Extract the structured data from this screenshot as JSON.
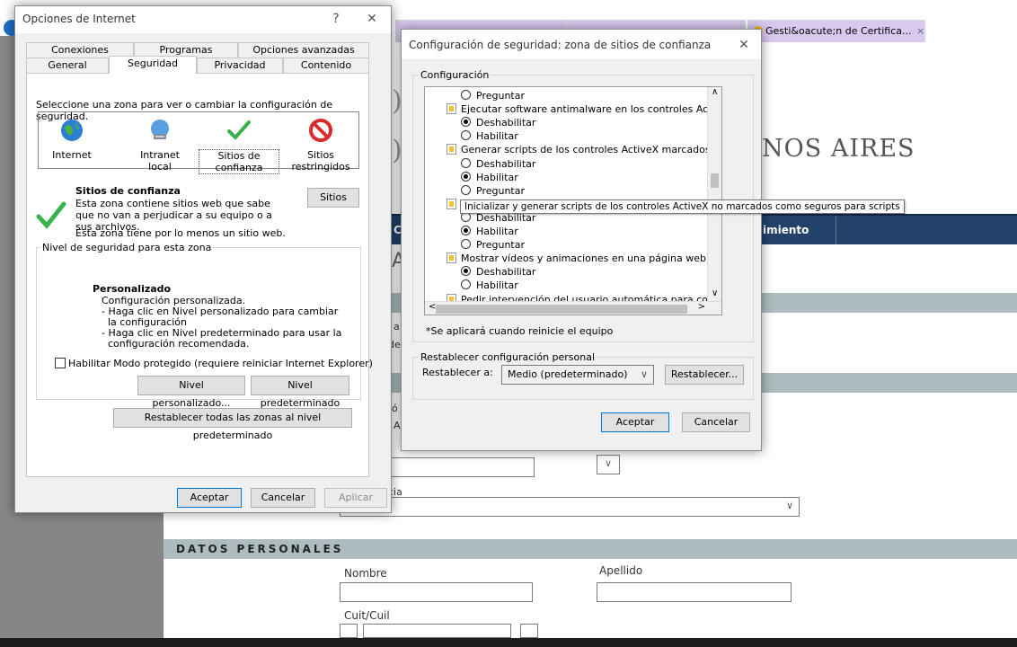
{
  "browser": {
    "tabs": [
      {
        "label": "Gesti&oacute;n de Certifica...",
        "close": "×"
      }
    ]
  },
  "webpage": {
    "header_text": "NOS AIRES",
    "nav": [
      "Co",
      "imiento"
    ],
    "fragments": [
      "Y",
      "A",
      "a",
      "de",
      "ó",
      "A",
      "cia"
    ],
    "section_personal": "DATOS PERSONALES",
    "labels": {
      "nombre": "Nombre",
      "apellido": "Apellido",
      "cuit": "Cuit/Cuil"
    }
  },
  "internet_options": {
    "title": "Opciones de Internet",
    "help": "?",
    "close": "✕",
    "tabs_row1": [
      "Conexiones",
      "Programas",
      "Opciones avanzadas"
    ],
    "tabs_row2": [
      "General",
      "Seguridad",
      "Privacidad",
      "Contenido"
    ],
    "zone_prompt": "Seleccione una zona para ver o cambiar la configuración de seguridad.",
    "zones": [
      "Internet",
      "Intranet local",
      "Sitios de confianza",
      "Sitios restringidos"
    ],
    "zone_title": "Sitios de confianza",
    "zone_desc": "Esta zona contiene sitios web que sabe que no van a perjudicar a su equipo o a sus archivos.",
    "zone_note": "Esta zona tiene por lo menos un sitio web.",
    "sites_button": "Sitios",
    "level_legend": "Nivel de seguridad para esta zona",
    "custom_title": "Personalizado",
    "custom_lines": [
      "Configuración personalizada.",
      "- Haga clic en Nivel personalizado para cambiar",
      "  la configuración",
      "- Haga clic en Nivel predeterminado para usar la",
      "  configuración recomendada."
    ],
    "protected_mode": "Habilitar Modo protegido (requiere reiniciar Internet Explorer)",
    "custom_level_button": "Nivel personalizado...",
    "default_level_button": "Nivel predeterminado",
    "reset_all_button": "Restablecer todas las zonas al nivel predeterminado",
    "ok": "Aceptar",
    "cancel": "Cancelar",
    "apply": "Aplicar"
  },
  "security_settings": {
    "title": "Configuración de seguridad: zona de sitios de confianza",
    "close": "✕",
    "config_legend": "Configuración",
    "items": [
      {
        "type": "option",
        "label": "Preguntar",
        "checked": false
      },
      {
        "type": "item",
        "label": "Ejecutar software antimalware en los controles ActiveX"
      },
      {
        "type": "option",
        "label": "Deshabilitar",
        "checked": true
      },
      {
        "type": "option",
        "label": "Habilitar",
        "checked": false
      },
      {
        "type": "item",
        "label": "Generar scripts de los controles ActiveX marcados como segu"
      },
      {
        "type": "option",
        "label": "Deshabilitar",
        "checked": false
      },
      {
        "type": "option",
        "label": "Habilitar",
        "checked": true
      },
      {
        "type": "option",
        "label": "Preguntar",
        "checked": false
      },
      {
        "type": "item",
        "label": "Inicializar y generar scripts de los controles ActiveX no marcados como seguros para scripts"
      },
      {
        "type": "option",
        "label": "Deshabilitar",
        "checked": false
      },
      {
        "type": "option",
        "label": "Habilitar",
        "checked": true
      },
      {
        "type": "option",
        "label": "Preguntar",
        "checked": false
      },
      {
        "type": "item",
        "label": "Mostrar vídeos y animaciones en una página web que no usa"
      },
      {
        "type": "option",
        "label": "Deshabilitar",
        "checked": true
      },
      {
        "type": "option",
        "label": "Habilitar",
        "checked": false
      },
      {
        "type": "item",
        "label": "Pedir intervención del usuario automática para controles Acti"
      }
    ],
    "restart_note": "*Se aplicará cuando reinicie el equipo",
    "reset_legend": "Restablecer configuración personal",
    "reset_label": "Restablecer a:",
    "reset_select": "Medio (predeterminado)",
    "reset_button": "Restablecer...",
    "ok": "Aceptar",
    "cancel": "Cancelar"
  },
  "colors": {
    "navbar": "#23426a",
    "band": "#aebcbf",
    "accent": "#0078d7"
  }
}
